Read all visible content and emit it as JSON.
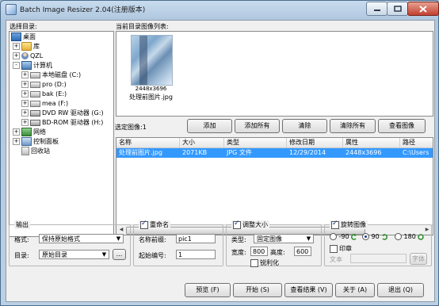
{
  "window": {
    "title": "Batch Image Resizer 2.04(注册版本)"
  },
  "directory": {
    "label": "选择目录:",
    "tree": [
      {
        "label": "桌面",
        "icon": "desktop-icon",
        "expander": ""
      },
      {
        "label": "库",
        "icon": "library-folder-icon",
        "expander": "+"
      },
      {
        "label": "QZL",
        "icon": "user-folder-icon",
        "expander": "+"
      },
      {
        "label": "计算机",
        "icon": "computer-icon",
        "expander": "-"
      },
      {
        "label": "本地磁盘 (C:)",
        "icon": "disk-icon",
        "expander": "+"
      },
      {
        "label": "pro (D:)",
        "icon": "disk-icon",
        "expander": "+"
      },
      {
        "label": "bak (E:)",
        "icon": "disk-icon",
        "expander": "+"
      },
      {
        "label": "mea (F:)",
        "icon": "disk-icon",
        "expander": "+"
      },
      {
        "label": "DVD RW 驱动器 (G:)",
        "icon": "dvd-drive-icon",
        "expander": "+"
      },
      {
        "label": "BD-ROM 驱动器 (H:)",
        "icon": "dvd-drive-icon",
        "expander": "+"
      },
      {
        "label": "网络",
        "icon": "network-icon",
        "expander": "+"
      },
      {
        "label": "控制面板",
        "icon": "control-panel-icon",
        "expander": "+"
      },
      {
        "label": "回收站",
        "icon": "recycle-bin-icon",
        "expander": ""
      }
    ]
  },
  "preview": {
    "label": "当前目录图像列表:",
    "thumbnail": {
      "dimensions": "2448x3696",
      "name": "处理前图片.jpg"
    }
  },
  "selection": {
    "label": "选定图像:1",
    "buttons": {
      "add": "添加",
      "add_all": "添加所有",
      "clear": "清除",
      "clear_all": "清除所有",
      "view": "查看图像"
    }
  },
  "file_table": {
    "columns": [
      "名称",
      "大小",
      "类型",
      "修改日期",
      "属性",
      "路径"
    ],
    "rows": [
      [
        "处理前图片.jpg",
        "2071KB",
        "JPG 文件",
        "12/29/2014",
        "2448x3696",
        "C:\\Users"
      ]
    ]
  },
  "output": {
    "title": "输出",
    "format_label": "格式:",
    "format_value": "保持原始格式",
    "dir_label": "目录:",
    "dir_value": "原始目录",
    "browse_label": "..."
  },
  "rename": {
    "title": "重命名",
    "checked": true,
    "prefix_label": "名称前缀:",
    "prefix_value": "pic1",
    "start_label": "起始编号:",
    "start_value": "1"
  },
  "resize": {
    "title": "调整大小",
    "checked": true,
    "type_label": "类型:",
    "type_value": "固定图像",
    "width_label": "宽度:",
    "width_value": "800",
    "height_label": "高度:",
    "height_value": "600",
    "sharpen_label": "锐利化",
    "sharpen_checked": false
  },
  "rotate": {
    "title": "旋转图像",
    "checked": true,
    "options": [
      "-90",
      "90",
      "180"
    ],
    "selected": "90"
  },
  "stamp": {
    "title": "印章",
    "checked": false,
    "text_label": "文本",
    "font_button": "字体"
  },
  "actions": {
    "preview": "预览 (F)",
    "start": "开始 (S)",
    "view_result": "查看结果 (V)",
    "about": "关于 (A)",
    "exit": "退出 (Q)"
  }
}
